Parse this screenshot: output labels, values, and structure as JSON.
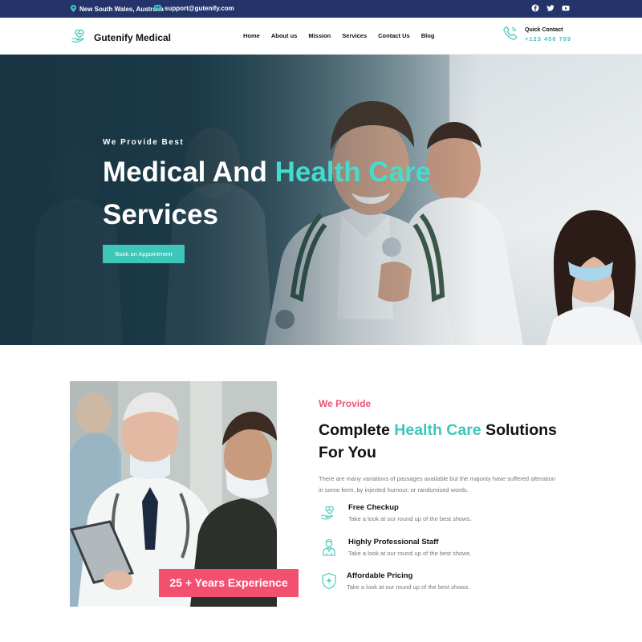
{
  "topbar": {
    "location": "New South Wales, Australia",
    "email": "support@gutenify.com",
    "social": [
      "facebook-icon",
      "twitter-icon",
      "youtube-icon"
    ]
  },
  "header": {
    "logo_text": "Gutenify Medical",
    "nav": [
      "Home",
      "About us",
      "Mission",
      "Services",
      "Contact Us",
      "Blog"
    ],
    "quick_contact_label": "Quick Contact",
    "quick_contact_number": "+123 456 789"
  },
  "hero": {
    "subtitle": "We Provide Best",
    "title_part1": "Medical And ",
    "title_highlight": "Health Care",
    "title_part2": "Services",
    "button": "Book an Appointment"
  },
  "section": {
    "badge": "25 + Years Experience",
    "eyebrow": "We Provide",
    "title_part1": "Complete ",
    "title_highlight": "Health Care",
    "title_part2": " Solutions For You",
    "description": "There are many variations of passages available but the majority have suffered alteration in some form, by injected humour, or randomised words.",
    "features": [
      {
        "icon": "heart-hand-icon",
        "title": "Free Checkup",
        "desc": "Take a look at our round up of the best shows."
      },
      {
        "icon": "doctor-icon",
        "title": "Highly Professional Staff",
        "desc": "Take a look at our round up of the best shows."
      },
      {
        "icon": "shield-plus-icon",
        "title": "Affordable Pricing",
        "desc": "Take a look at our round up of the best shows."
      }
    ]
  },
  "colors": {
    "accent": "#3ec6b8",
    "pink": "#f2506f",
    "topbar": "#24346a"
  }
}
